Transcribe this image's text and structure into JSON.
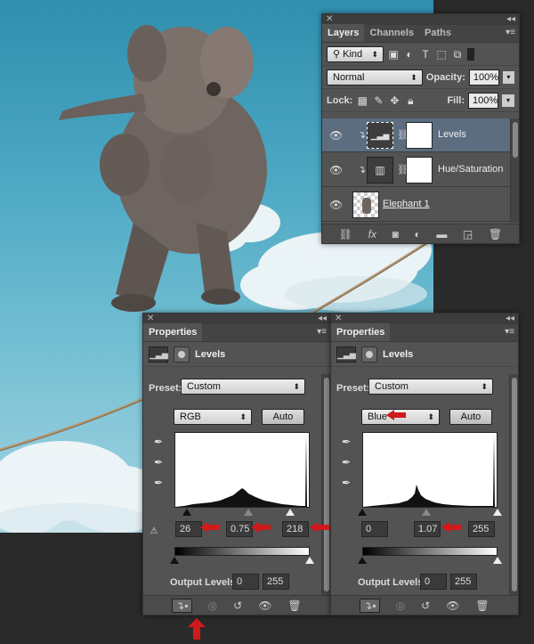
{
  "layers_panel": {
    "tabs": [
      {
        "label": "Layers",
        "active": true
      },
      {
        "label": "Channels",
        "active": false
      },
      {
        "label": "Paths",
        "active": false
      }
    ],
    "filter": {
      "label": "Kind"
    },
    "blend_mode": {
      "label": "Normal"
    },
    "opacity": {
      "label": "Opacity:",
      "value": "100%"
    },
    "lock": {
      "label": "Lock:"
    },
    "fill": {
      "label": "Fill:",
      "value": "100%"
    },
    "layers": [
      {
        "name": "Levels",
        "selected": true,
        "type": "adjustment-levels"
      },
      {
        "name": "Hue/Saturation",
        "selected": false,
        "type": "adjustment-hue"
      },
      {
        "name": "Elephant 1",
        "selected": false,
        "type": "pixel"
      }
    ]
  },
  "properties_left": {
    "tab_label": "Properties",
    "title": "Levels",
    "preset_label": "Preset:",
    "preset_value": "Custom",
    "channel": "RGB",
    "auto_label": "Auto",
    "input_black": "26",
    "input_gamma": "0.75",
    "input_white": "218",
    "output_label": "Output Levels:",
    "output_black": "0",
    "output_white": "255"
  },
  "properties_right": {
    "tab_label": "Properties",
    "title": "Levels",
    "preset_label": "Preset:",
    "preset_value": "Custom",
    "channel": "Blue",
    "auto_label": "Auto",
    "input_black": "0",
    "input_gamma": "1.07",
    "input_white": "255",
    "output_label": "Output Levels:",
    "output_black": "0",
    "output_white": "255"
  },
  "colors": {
    "panel_bg": "#535353",
    "selected_layer": "#5d6d80",
    "annotation_red": "#d0191b",
    "sky": "#4ea9c4"
  }
}
